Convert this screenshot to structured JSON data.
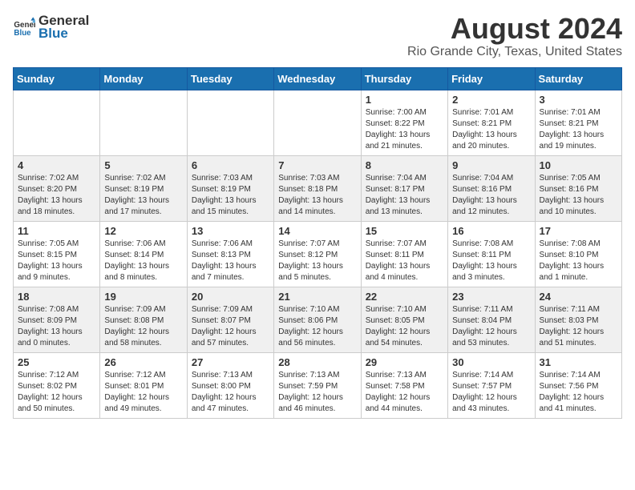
{
  "app": {
    "logo_general": "General",
    "logo_blue": "Blue"
  },
  "header": {
    "title": "August 2024",
    "subtitle": "Rio Grande City, Texas, United States"
  },
  "calendar": {
    "weekdays": [
      "Sunday",
      "Monday",
      "Tuesday",
      "Wednesday",
      "Thursday",
      "Friday",
      "Saturday"
    ],
    "rows": [
      [
        {
          "day": "",
          "info": ""
        },
        {
          "day": "",
          "info": ""
        },
        {
          "day": "",
          "info": ""
        },
        {
          "day": "",
          "info": ""
        },
        {
          "day": "1",
          "info": "Sunrise: 7:00 AM\nSunset: 8:22 PM\nDaylight: 13 hours and 21 minutes."
        },
        {
          "day": "2",
          "info": "Sunrise: 7:01 AM\nSunset: 8:21 PM\nDaylight: 13 hours and 20 minutes."
        },
        {
          "day": "3",
          "info": "Sunrise: 7:01 AM\nSunset: 8:21 PM\nDaylight: 13 hours and 19 minutes."
        }
      ],
      [
        {
          "day": "4",
          "info": "Sunrise: 7:02 AM\nSunset: 8:20 PM\nDaylight: 13 hours and 18 minutes."
        },
        {
          "day": "5",
          "info": "Sunrise: 7:02 AM\nSunset: 8:19 PM\nDaylight: 13 hours and 17 minutes."
        },
        {
          "day": "6",
          "info": "Sunrise: 7:03 AM\nSunset: 8:19 PM\nDaylight: 13 hours and 15 minutes."
        },
        {
          "day": "7",
          "info": "Sunrise: 7:03 AM\nSunset: 8:18 PM\nDaylight: 13 hours and 14 minutes."
        },
        {
          "day": "8",
          "info": "Sunrise: 7:04 AM\nSunset: 8:17 PM\nDaylight: 13 hours and 13 minutes."
        },
        {
          "day": "9",
          "info": "Sunrise: 7:04 AM\nSunset: 8:16 PM\nDaylight: 13 hours and 12 minutes."
        },
        {
          "day": "10",
          "info": "Sunrise: 7:05 AM\nSunset: 8:16 PM\nDaylight: 13 hours and 10 minutes."
        }
      ],
      [
        {
          "day": "11",
          "info": "Sunrise: 7:05 AM\nSunset: 8:15 PM\nDaylight: 13 hours and 9 minutes."
        },
        {
          "day": "12",
          "info": "Sunrise: 7:06 AM\nSunset: 8:14 PM\nDaylight: 13 hours and 8 minutes."
        },
        {
          "day": "13",
          "info": "Sunrise: 7:06 AM\nSunset: 8:13 PM\nDaylight: 13 hours and 7 minutes."
        },
        {
          "day": "14",
          "info": "Sunrise: 7:07 AM\nSunset: 8:12 PM\nDaylight: 13 hours and 5 minutes."
        },
        {
          "day": "15",
          "info": "Sunrise: 7:07 AM\nSunset: 8:11 PM\nDaylight: 13 hours and 4 minutes."
        },
        {
          "day": "16",
          "info": "Sunrise: 7:08 AM\nSunset: 8:11 PM\nDaylight: 13 hours and 3 minutes."
        },
        {
          "day": "17",
          "info": "Sunrise: 7:08 AM\nSunset: 8:10 PM\nDaylight: 13 hours and 1 minute."
        }
      ],
      [
        {
          "day": "18",
          "info": "Sunrise: 7:08 AM\nSunset: 8:09 PM\nDaylight: 13 hours and 0 minutes."
        },
        {
          "day": "19",
          "info": "Sunrise: 7:09 AM\nSunset: 8:08 PM\nDaylight: 12 hours and 58 minutes."
        },
        {
          "day": "20",
          "info": "Sunrise: 7:09 AM\nSunset: 8:07 PM\nDaylight: 12 hours and 57 minutes."
        },
        {
          "day": "21",
          "info": "Sunrise: 7:10 AM\nSunset: 8:06 PM\nDaylight: 12 hours and 56 minutes."
        },
        {
          "day": "22",
          "info": "Sunrise: 7:10 AM\nSunset: 8:05 PM\nDaylight: 12 hours and 54 minutes."
        },
        {
          "day": "23",
          "info": "Sunrise: 7:11 AM\nSunset: 8:04 PM\nDaylight: 12 hours and 53 minutes."
        },
        {
          "day": "24",
          "info": "Sunrise: 7:11 AM\nSunset: 8:03 PM\nDaylight: 12 hours and 51 minutes."
        }
      ],
      [
        {
          "day": "25",
          "info": "Sunrise: 7:12 AM\nSunset: 8:02 PM\nDaylight: 12 hours and 50 minutes."
        },
        {
          "day": "26",
          "info": "Sunrise: 7:12 AM\nSunset: 8:01 PM\nDaylight: 12 hours and 49 minutes."
        },
        {
          "day": "27",
          "info": "Sunrise: 7:13 AM\nSunset: 8:00 PM\nDaylight: 12 hours and 47 minutes."
        },
        {
          "day": "28",
          "info": "Sunrise: 7:13 AM\nSunset: 7:59 PM\nDaylight: 12 hours and 46 minutes."
        },
        {
          "day": "29",
          "info": "Sunrise: 7:13 AM\nSunset: 7:58 PM\nDaylight: 12 hours and 44 minutes."
        },
        {
          "day": "30",
          "info": "Sunrise: 7:14 AM\nSunset: 7:57 PM\nDaylight: 12 hours and 43 minutes."
        },
        {
          "day": "31",
          "info": "Sunrise: 7:14 AM\nSunset: 7:56 PM\nDaylight: 12 hours and 41 minutes."
        }
      ]
    ]
  }
}
